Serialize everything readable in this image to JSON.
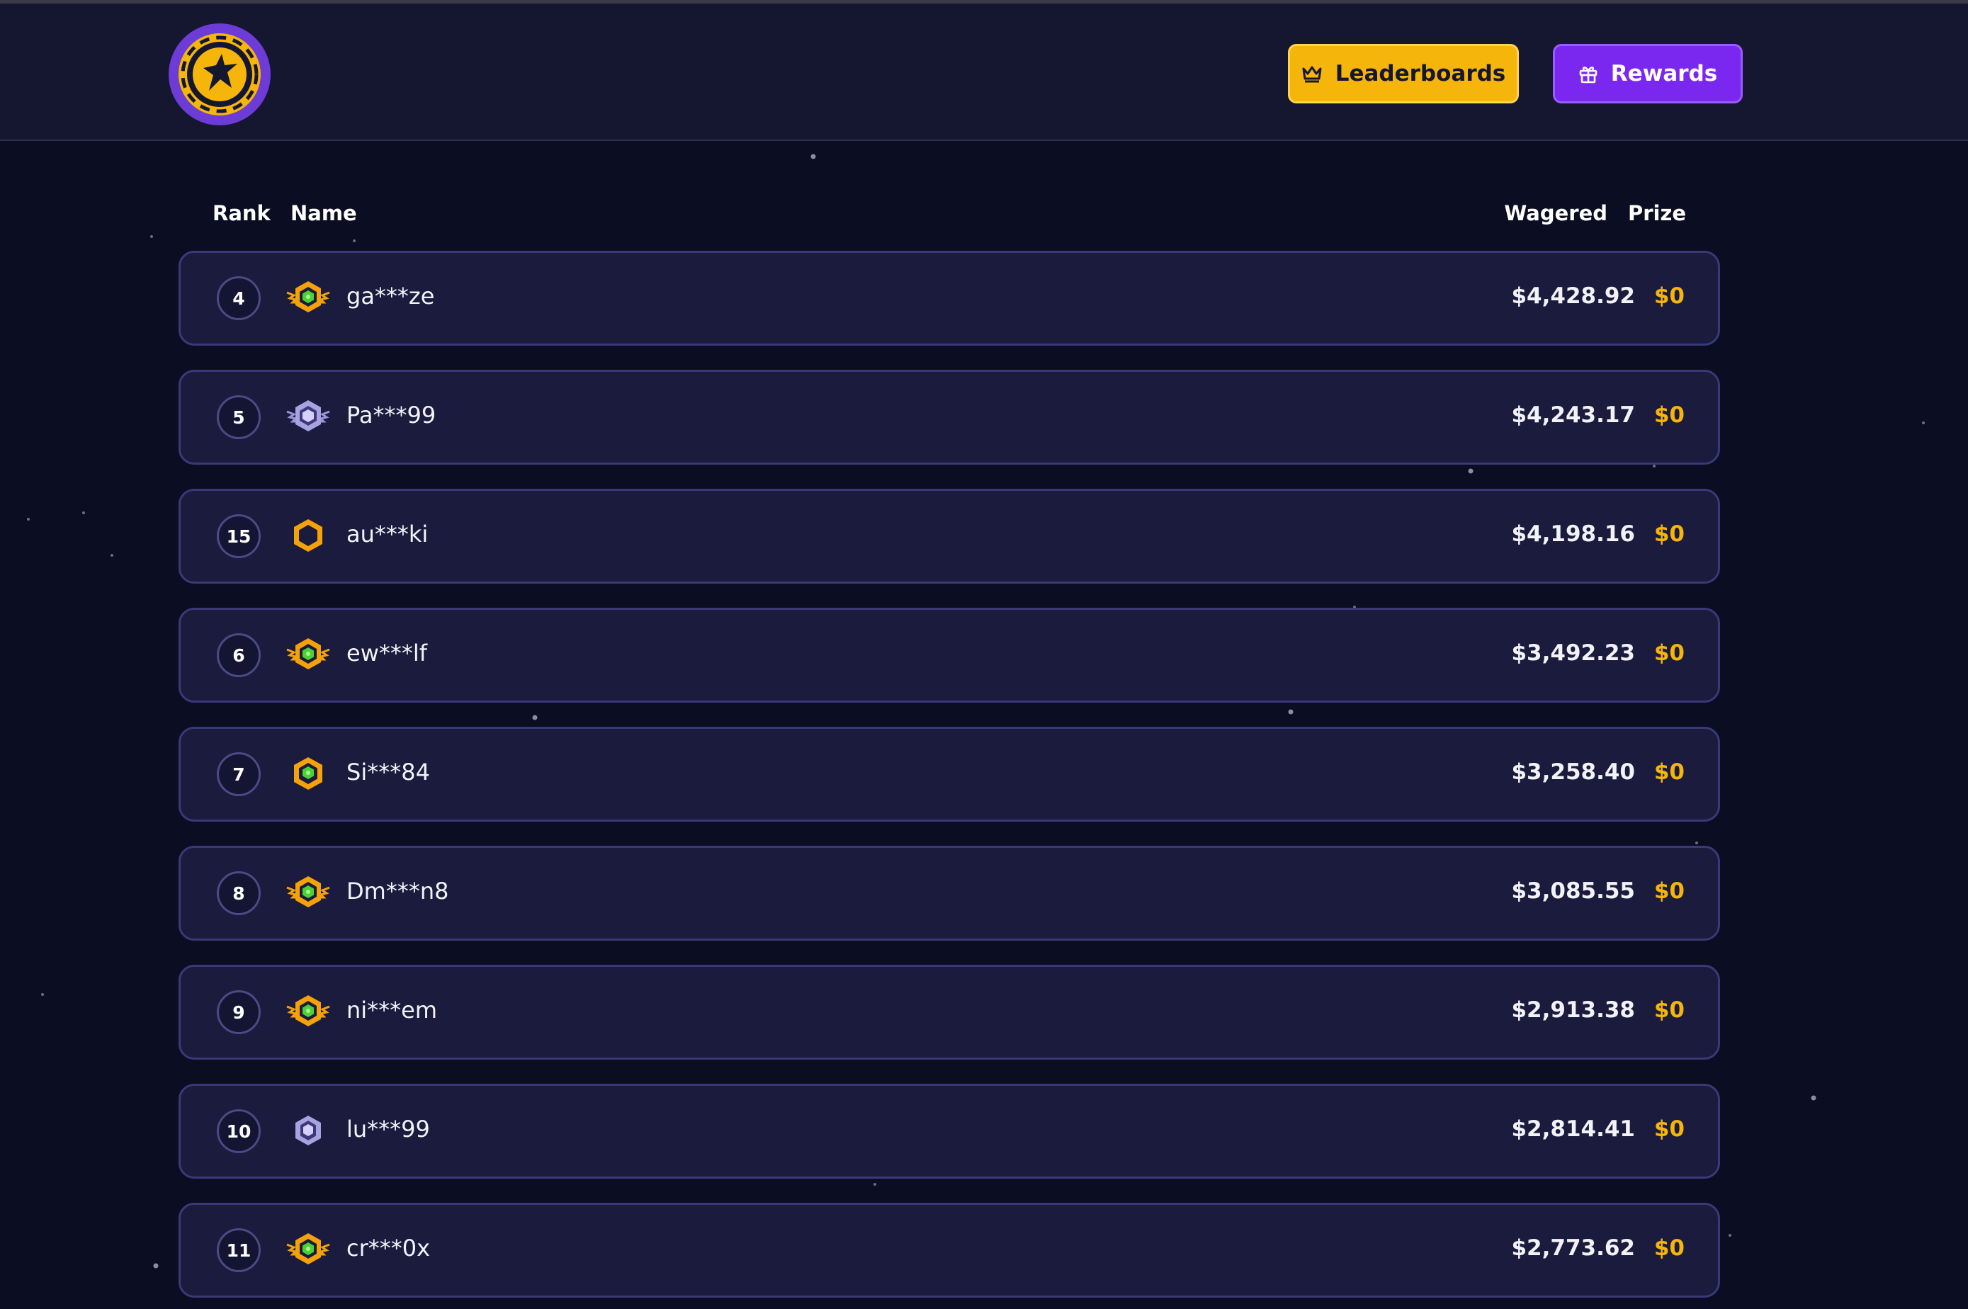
{
  "header": {
    "leaderboards_label": "Leaderboards",
    "rewards_label": "Rewards",
    "colors": {
      "bg": "#15162f",
      "leader_btn": "#f5b50a",
      "rewards_btn": "#7a28f0"
    }
  },
  "table": {
    "columns": {
      "rank": "Rank",
      "name": "Name",
      "wagered": "Wagered",
      "prize": "Prize"
    },
    "rows": [
      {
        "rank": "4",
        "badge": "gold-winged",
        "name": "ga***ze",
        "wagered": "$4,428.92",
        "prize": "$0"
      },
      {
        "rank": "5",
        "badge": "silver-winged",
        "name": "Pa***99",
        "wagered": "$4,243.17",
        "prize": "$0"
      },
      {
        "rank": "15",
        "badge": "gold-hollow",
        "name": "au***ki",
        "wagered": "$4,198.16",
        "prize": "$0"
      },
      {
        "rank": "6",
        "badge": "gold-winged",
        "name": "ew***lf",
        "wagered": "$3,492.23",
        "prize": "$0"
      },
      {
        "rank": "7",
        "badge": "gold-gem",
        "name": "Si***84",
        "wagered": "$3,258.40",
        "prize": "$0"
      },
      {
        "rank": "8",
        "badge": "gold-winged",
        "name": "Dm***n8",
        "wagered": "$3,085.55",
        "prize": "$0"
      },
      {
        "rank": "9",
        "badge": "gold-winged",
        "name": "ni***em",
        "wagered": "$2,913.38",
        "prize": "$0"
      },
      {
        "rank": "10",
        "badge": "silver-gem",
        "name": "lu***99",
        "wagered": "$2,814.41",
        "prize": "$0"
      },
      {
        "rank": "11",
        "badge": "gold-winged",
        "name": "cr***0x",
        "wagered": "$2,773.62",
        "prize": "$0"
      }
    ]
  }
}
